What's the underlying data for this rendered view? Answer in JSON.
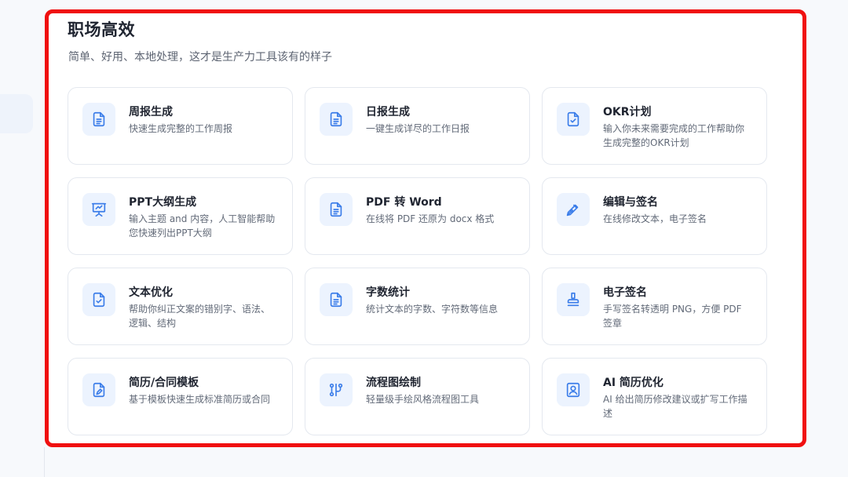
{
  "section": {
    "title": "职场高效",
    "subtitle": "简单、好用、本地处理，这才是生产力工具该有的样子"
  },
  "colors": {
    "accent": "#3b7de9",
    "icon_bg": "#ecf3fe",
    "highlight_border": "#f01010"
  },
  "tools": [
    {
      "title": "周报生成",
      "desc": "快速生成完整的工作周报",
      "icon": "document-icon"
    },
    {
      "title": "日报生成",
      "desc": "一键生成详尽的工作日报",
      "icon": "document-icon"
    },
    {
      "title": "OKR计划",
      "desc": "输入你未来需要完成的工作帮助你生成完整的OKR计划",
      "icon": "document-check-icon"
    },
    {
      "title": "PPT大纲生成",
      "desc": "输入主题 and 内容，人工智能帮助您快速列出PPT大纲",
      "icon": "presentation-icon"
    },
    {
      "title": "PDF 转 Word",
      "desc": "在线将 PDF 还原为 docx 格式",
      "icon": "document-icon"
    },
    {
      "title": "编辑与签名",
      "desc": "在线修改文本，电子签名",
      "icon": "pen-nib-icon"
    },
    {
      "title": "文本优化",
      "desc": "帮助你纠正文案的错别字、语法、逻辑、结构",
      "icon": "document-check-icon"
    },
    {
      "title": "字数统计",
      "desc": "统计文本的字数、字符数等信息",
      "icon": "document-icon"
    },
    {
      "title": "电子签名",
      "desc": "手写签名转透明 PNG，方便 PDF 签章",
      "icon": "stamp-icon"
    },
    {
      "title": "简历/合同模板",
      "desc": "基于模板快速生成标准简历或合同",
      "icon": "document-edit-icon"
    },
    {
      "title": "流程图绘制",
      "desc": "轻量级手绘风格流程图工具",
      "icon": "flowchart-icon"
    },
    {
      "title": "AI 简历优化",
      "desc": "AI 给出简历修改建议或扩写工作描述",
      "icon": "profile-card-icon"
    }
  ]
}
